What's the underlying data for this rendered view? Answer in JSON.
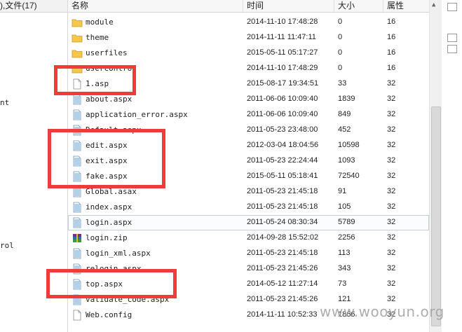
{
  "left_pane": {
    "header_fragment": "),文件(17)",
    "fragments": [
      "nt",
      "rol"
    ]
  },
  "columns": {
    "name": "名称",
    "time": "时间",
    "size": "大小",
    "attr": "属性"
  },
  "files": [
    {
      "name": "module",
      "type": "folder",
      "time": "2014-11-10 17:48:28",
      "size": "0",
      "attr": "16"
    },
    {
      "name": "theme",
      "type": "folder",
      "time": "2014-11-11 11:47:11",
      "size": "0",
      "attr": "16"
    },
    {
      "name": "userfiles",
      "type": "folder",
      "time": "2015-05-11 05:17:27",
      "size": "0",
      "attr": "16"
    },
    {
      "name": "usercontrol",
      "type": "folder",
      "time": "2014-11-10 17:48:29",
      "size": "0",
      "attr": "16"
    },
    {
      "name": "1.asp",
      "type": "asp",
      "time": "2015-08-17 19:34:51",
      "size": "33",
      "attr": "32"
    },
    {
      "name": "about.aspx",
      "type": "aspx",
      "time": "2011-06-06 10:09:40",
      "size": "1839",
      "attr": "32"
    },
    {
      "name": "application_error.aspx",
      "type": "aspx",
      "time": "2011-06-06 10:09:40",
      "size": "849",
      "attr": "32"
    },
    {
      "name": "Default.aspx",
      "type": "aspx",
      "time": "2011-05-23 23:48:00",
      "size": "452",
      "attr": "32"
    },
    {
      "name": "edit.aspx",
      "type": "aspx",
      "time": "2012-03-04 18:04:56",
      "size": "10598",
      "attr": "32"
    },
    {
      "name": "exit.aspx",
      "type": "aspx",
      "time": "2011-05-23 22:24:44",
      "size": "1093",
      "attr": "32"
    },
    {
      "name": "fake.aspx",
      "type": "aspx",
      "time": "2015-05-11 05:18:41",
      "size": "72540",
      "attr": "32"
    },
    {
      "name": "Global.asax",
      "type": "asax",
      "time": "2011-05-23 21:45:18",
      "size": "91",
      "attr": "32"
    },
    {
      "name": "index.aspx",
      "type": "aspx",
      "time": "2011-05-23 21:45:18",
      "size": "105",
      "attr": "32"
    },
    {
      "name": "login.aspx",
      "type": "aspx",
      "time": "2011-05-24 08:30:34",
      "size": "5789",
      "attr": "32",
      "selected": true
    },
    {
      "name": "login.zip",
      "type": "zip",
      "time": "2014-09-28 15:52:02",
      "size": "2256",
      "attr": "32"
    },
    {
      "name": "login_xml.aspx",
      "type": "aspx",
      "time": "2011-05-23 21:45:18",
      "size": "113",
      "attr": "32"
    },
    {
      "name": "relogin.aspx",
      "type": "aspx",
      "time": "2011-05-23 21:45:26",
      "size": "343",
      "attr": "32"
    },
    {
      "name": "top.aspx",
      "type": "aspx",
      "time": "2014-05-12 11:27:14",
      "size": "73",
      "attr": "32"
    },
    {
      "name": "validate_code.aspx",
      "type": "aspx",
      "time": "2011-05-23 21:45:26",
      "size": "121",
      "attr": "32"
    },
    {
      "name": "Web.config",
      "type": "config",
      "time": "2014-11-11 10:52:33",
      "size": "1866",
      "attr": "32"
    }
  ],
  "watermark": "www.wooyun.org",
  "colors": {
    "highlight_box": "#ee3b3b",
    "folder": "#f5c84b",
    "aspx_icon": "#7fb3d9"
  }
}
